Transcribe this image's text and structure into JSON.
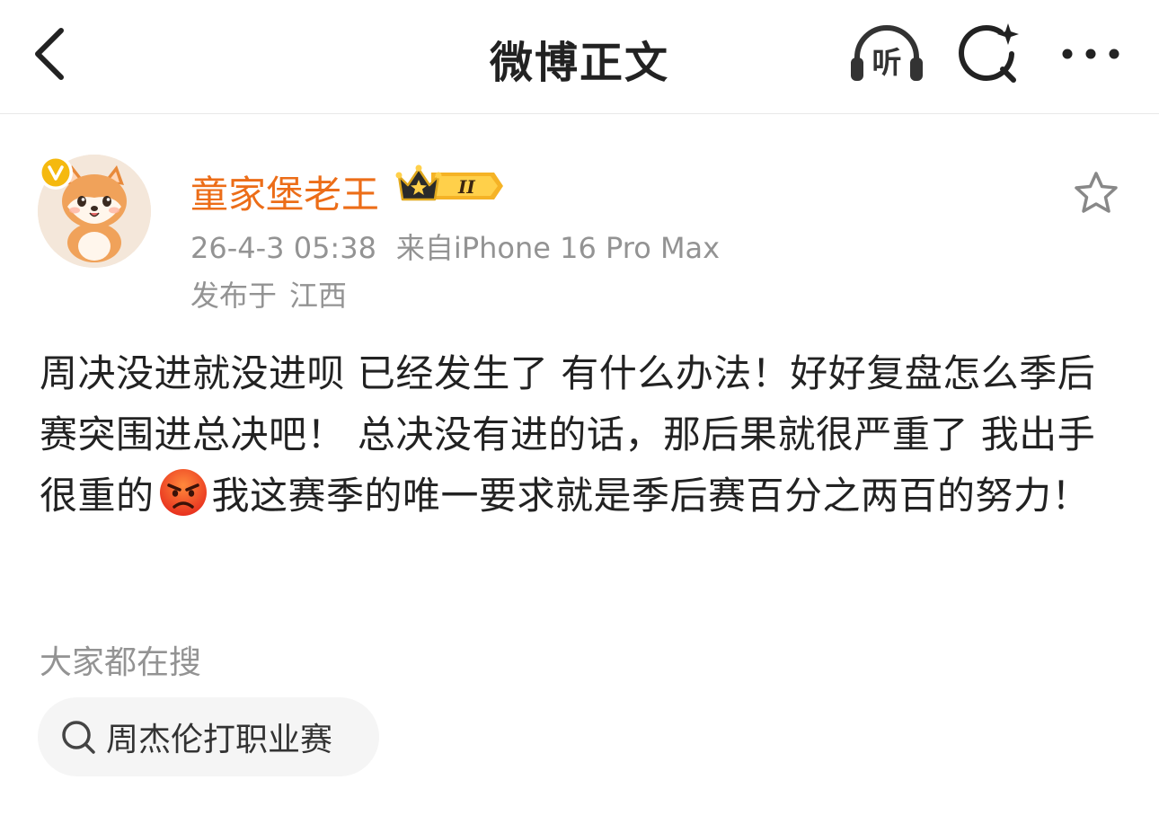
{
  "navbar": {
    "title": "微博正文",
    "listen_label": "听",
    "back_icon": "chevron-left-icon",
    "search_icon": "sparkle-search-icon",
    "more_icon": "more-dots-icon"
  },
  "post": {
    "author": "童家堡老王",
    "vip_level": "II",
    "time": "26-4-3 05:38",
    "source": "来自iPhone 16 Pro Max",
    "location_label": "发布于",
    "location": "江西",
    "content_before_emoji": "周决没进就没进呗 已经发生了 有什么办法！好好复盘怎么季后赛突围进总决吧！ 总决没有进的话，那后果就很严重了 我出手很重的",
    "content_after_emoji": "我这赛季的唯一要求就是季后赛百分之两百的努力！"
  },
  "trending": {
    "heading": "大家都在搜",
    "items": [
      {
        "label": "周杰伦打职业赛"
      }
    ]
  },
  "colors": {
    "username": "#ec6d18",
    "meta": "#939393",
    "text": "#222222",
    "chip_bg": "#f5f5f5",
    "verified": "#f5b90f"
  }
}
